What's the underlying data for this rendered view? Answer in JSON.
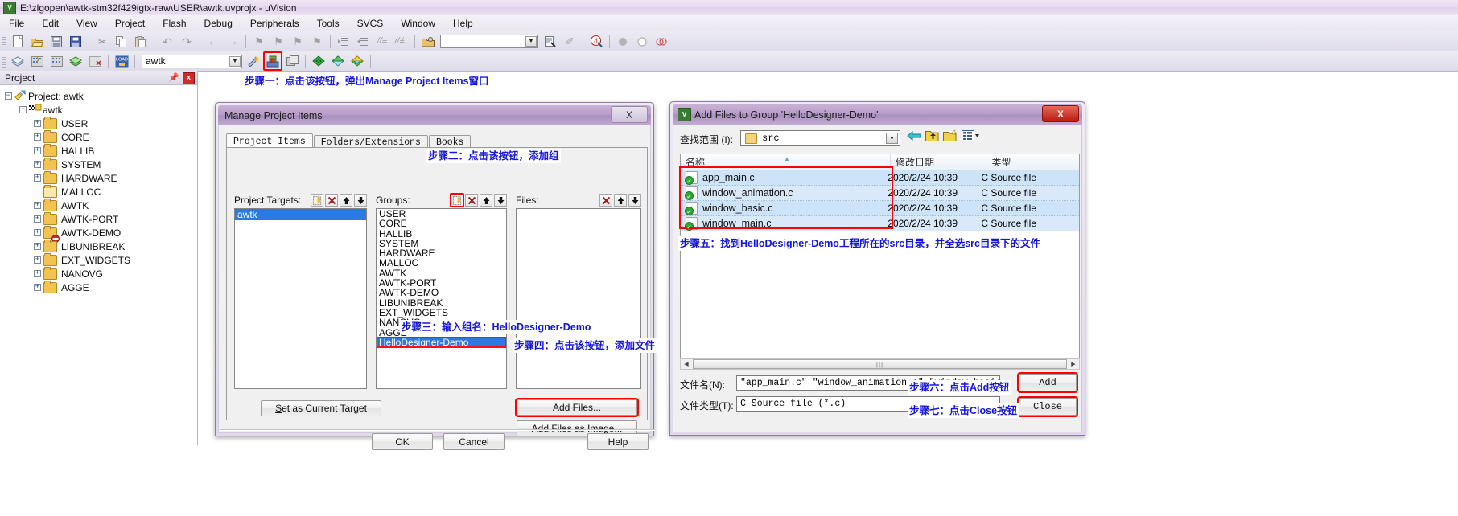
{
  "window": {
    "title": "E:\\zlgopen\\awtk-stm32f429igtx-raw\\USER\\awtk.uvprojx - µVision",
    "icon": "uvision-icon"
  },
  "menubar": {
    "items": [
      "File",
      "Edit",
      "View",
      "Project",
      "Flash",
      "Debug",
      "Peripherals",
      "Tools",
      "SVCS",
      "Window",
      "Help"
    ]
  },
  "toolbar2": {
    "target_value": "awtk",
    "find_value": ""
  },
  "project_pane": {
    "title": "Project",
    "pin_icon": "pin-icon",
    "close_label": "x",
    "root": "Project: awtk",
    "target": "awtk",
    "groups": [
      "USER",
      "CORE",
      "HALLIB",
      "SYSTEM",
      "HARDWARE",
      "MALLOC",
      "AWTK",
      "AWTK-PORT",
      "AWTK-DEMO",
      "LIBUNIBREAK",
      "EXT_WIDGETS",
      "NANOVG",
      "AGGE"
    ]
  },
  "notes": {
    "step1": "步骤一：点击该按钮，弹出Manage Project Items窗口",
    "step2": "步骤二：点击该按钮，添加组",
    "step3": "步骤三：输入组名：HelloDesigner-Demo",
    "step4": "步骤四：点击该按钮，添加文件",
    "step5": "步骤五：找到HelloDesigner-Demo工程所在的src目录，并全选src目录下的文件",
    "step6": "步骤六：点击Add按钮",
    "step7": "步骤七：点击Close按钮"
  },
  "manage_dialog": {
    "title": "Manage Project Items",
    "close_label": "X",
    "tabs": [
      "Project Items",
      "Folders/Extensions",
      "Books"
    ],
    "active_tab": "Project Items",
    "project_targets_label": "Project Targets:",
    "groups_label": "Groups:",
    "files_label": "Files:",
    "targets": [
      "awtk"
    ],
    "selected_target": "awtk",
    "groups": [
      "USER",
      "CORE",
      "HALLIB",
      "SYSTEM",
      "HARDWARE",
      "MALLOC",
      "AWTK",
      "AWTK-PORT",
      "AWTK-DEMO",
      "LIBUNIBREAK",
      "EXT_WIDGETS",
      "NANOVG",
      "AGGE",
      "HelloDesigner-Demo"
    ],
    "selected_group": "HelloDesigner-Demo",
    "files": [],
    "set_as_current_target": "Set as Current Target",
    "add_files": "Add Files...",
    "add_files_as_image": "Add Files as Image...",
    "ok": "OK",
    "cancel": "Cancel",
    "help": "Help"
  },
  "add_files_dialog": {
    "title": "Add Files to Group 'HelloDesigner-Demo'",
    "close_label": "X",
    "lookin_label": "查找范围 (I):",
    "lookin_value": "src",
    "nav_icons": [
      "back-arrow-icon",
      "up-folder-icon",
      "new-folder-icon",
      "views-icon"
    ],
    "columns": [
      "名称",
      "修改日期",
      "类型"
    ],
    "rows": [
      {
        "name": "app_main.c",
        "date": "2020/2/24 10:39",
        "type": "C Source file"
      },
      {
        "name": "window_animation.c",
        "date": "2020/2/24 10:39",
        "type": "C Source file"
      },
      {
        "name": "window_basic.c",
        "date": "2020/2/24 10:39",
        "type": "C Source file"
      },
      {
        "name": "window_main.c",
        "date": "2020/2/24 10:39",
        "type": "C Source file"
      }
    ],
    "filename_label": "文件名(N):",
    "filename_value": "\"app_main.c\" \"window_animation.c\" \"window_basic.c\" \"window_main.c\"",
    "filetype_label": "文件类型(T):",
    "filetype_value": "C Source file (*.c)",
    "add_button": "Add",
    "close_button": "Close"
  }
}
